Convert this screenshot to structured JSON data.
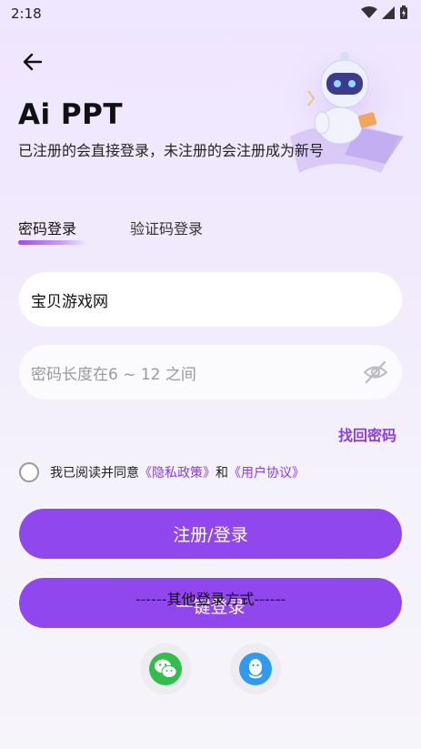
{
  "status_bar": {
    "time": "2:18"
  },
  "header": {
    "title": "Ai PPT",
    "subtitle": "已注册的会直接登录，未注册的会注册成为新号"
  },
  "tabs": [
    {
      "label": "密码登录",
      "active": true
    },
    {
      "label": "验证码登录",
      "active": false
    }
  ],
  "form": {
    "username_value": "宝贝游戏网",
    "password_placeholder": "密码长度在6 ~ 12 之间",
    "forgot_password": "找回密码"
  },
  "agreement": {
    "prefix": "我已阅读并同意",
    "privacy": "《隐私政策》",
    "and": "和",
    "terms": "《用户协议》",
    "checked": false
  },
  "buttons": {
    "login": "注册/登录",
    "one_click": "一键登录"
  },
  "other_login": {
    "label": "------其他登录方式------",
    "methods": [
      "wechat-icon",
      "qq-icon"
    ]
  },
  "colors": {
    "accent": "#9147ee",
    "link": "#8a3fe6"
  }
}
